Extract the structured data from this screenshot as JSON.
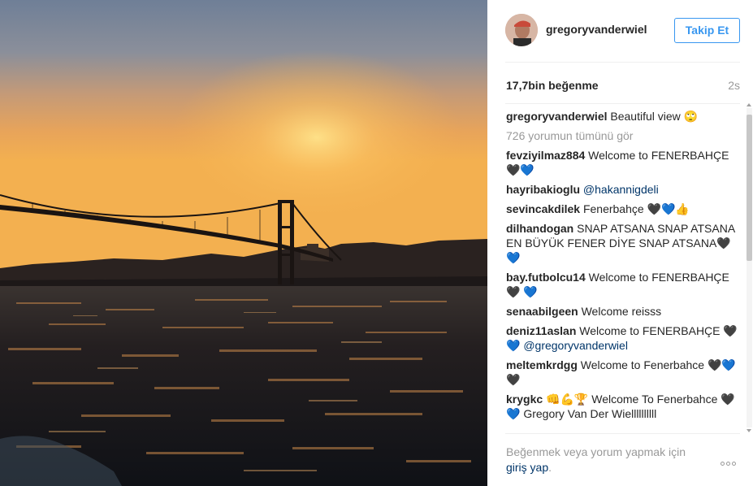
{
  "post": {
    "username": "gregoryvanderwiel",
    "follow_label": "Takip Et",
    "likes": "17,7bin beğenme",
    "time_ago": "2s",
    "caption_author": "gregoryvanderwiel",
    "caption_text": " Beautiful view 🙄",
    "view_all_comments": "726 yorumun tümünü gör"
  },
  "comments": [
    {
      "author": "fevziyilmaz884",
      "text": " Welcome to FENERBAHÇE 🖤💙",
      "mention": ""
    },
    {
      "author": "hayribakioglu",
      "text": " ",
      "mention": "@hakannigdeli"
    },
    {
      "author": "sevincakdilek",
      "text": " Fenerbahçe 🖤💙👍",
      "mention": ""
    },
    {
      "author": "dilhandogan",
      "text": " SNAP ATSANA SNAP ATSANA EN BÜYÜK FENER DİYE SNAP ATSANA🖤💙",
      "mention": ""
    },
    {
      "author": "bay.futbolcu14",
      "text": " Welcome to FENERBAHÇE 🖤 💙",
      "mention": ""
    },
    {
      "author": "senaabilgeen",
      "text": " Welcome reisss",
      "mention": ""
    },
    {
      "author": "deniz11aslan",
      "text": " Welcome to FENERBAHÇE 🖤💙 ",
      "mention": "@gregoryvanderwiel"
    },
    {
      "author": "meltemkrdgg",
      "text": " Welcome to Fenerbahce 🖤💙🖤",
      "mention": ""
    },
    {
      "author": "krygkc",
      "text": " 👊💪🏆 Welcome To Fenerbahce 🖤💙 Gregory Van Der Wiellllllllll",
      "mention": ""
    }
  ],
  "footer": {
    "login_prompt": "Beğenmek veya yorum yapmak için",
    "login_link": "giriş yap",
    "login_suffix": "."
  },
  "icons": {
    "more": "more-options-icon",
    "avatar": "avatar"
  },
  "colors": {
    "follow_blue": "#3897f0",
    "link_blue": "#003569",
    "muted": "#999999"
  }
}
